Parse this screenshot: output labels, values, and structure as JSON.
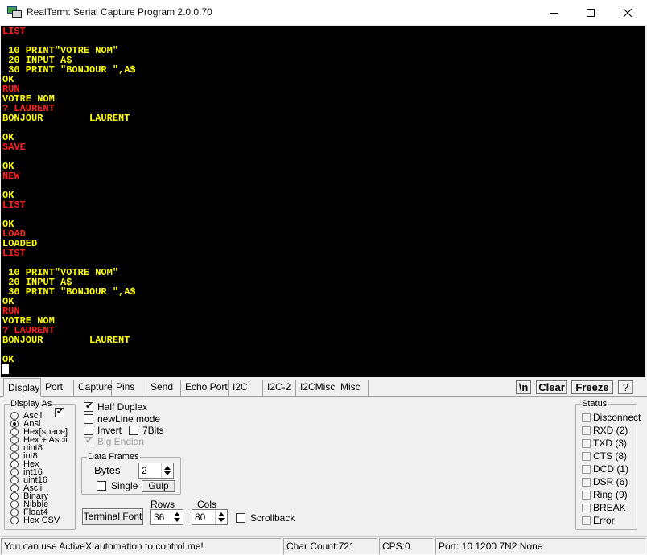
{
  "window": {
    "title": "RealTerm: Serial Capture Program 2.0.0.70"
  },
  "terminal": {
    "colors": {
      "background": "#000000",
      "echo": "#ff2020",
      "received": "#ffff00"
    },
    "lines": [
      {
        "text": "LIST",
        "color": "r"
      },
      {
        "text": "",
        "color": "y"
      },
      {
        "text": " 10 PRINT\"VOTRE NOM\"",
        "color": "y"
      },
      {
        "text": " 20 INPUT A$",
        "color": "y"
      },
      {
        "text": " 30 PRINT \"BONJOUR \",A$",
        "color": "y"
      },
      {
        "text": "OK",
        "color": "y"
      },
      {
        "text": "RUN",
        "color": "r"
      },
      {
        "text": "VOTRE NOM",
        "color": "y"
      },
      {
        "text": "? LAURENT",
        "color": "r"
      },
      {
        "text": "BONJOUR        LAURENT",
        "color": "y"
      },
      {
        "text": "",
        "color": "y"
      },
      {
        "text": "OK",
        "color": "y"
      },
      {
        "text": "SAVE",
        "color": "r"
      },
      {
        "text": "",
        "color": "y"
      },
      {
        "text": "OK",
        "color": "y"
      },
      {
        "text": "NEW",
        "color": "r"
      },
      {
        "text": "",
        "color": "y"
      },
      {
        "text": "OK",
        "color": "y"
      },
      {
        "text": "LIST",
        "color": "r"
      },
      {
        "text": "",
        "color": "y"
      },
      {
        "text": "OK",
        "color": "y"
      },
      {
        "text": "LOAD",
        "color": "r"
      },
      {
        "text": "LOADED",
        "color": "y"
      },
      {
        "text": "LIST",
        "color": "r"
      },
      {
        "text": "",
        "color": "y"
      },
      {
        "text": " 10 PRINT\"VOTRE NOM\"",
        "color": "y"
      },
      {
        "text": " 20 INPUT A$",
        "color": "y"
      },
      {
        "text": " 30 PRINT \"BONJOUR \",A$",
        "color": "y"
      },
      {
        "text": "OK",
        "color": "y"
      },
      {
        "text": "RUN",
        "color": "r"
      },
      {
        "text": "VOTRE NOM",
        "color": "y"
      },
      {
        "text": "? LAURENT",
        "color": "r"
      },
      {
        "text": "BONJOUR        LAURENT",
        "color": "y"
      },
      {
        "text": "",
        "color": "y"
      },
      {
        "text": "OK",
        "color": "y"
      }
    ]
  },
  "tabs": [
    {
      "label": "Display",
      "active": true
    },
    {
      "label": "Port"
    },
    {
      "label": "Capture"
    },
    {
      "label": "Pins"
    },
    {
      "label": "Send"
    },
    {
      "label": "Echo Port"
    },
    {
      "label": "I2C"
    },
    {
      "label": "I2C-2"
    },
    {
      "label": "I2CMisc"
    },
    {
      "label": "Misc"
    }
  ],
  "toolbar": {
    "newline_label": "\\n",
    "clear_label": "Clear",
    "freeze_label": "Freeze",
    "help_label": "?"
  },
  "display_as": {
    "legend": "Display As",
    "options": [
      {
        "label": "Ascii"
      },
      {
        "label": "Ansi",
        "selected": true
      },
      {
        "label": "Hex[space]"
      },
      {
        "label": "Hex + Ascii"
      },
      {
        "label": "uint8"
      },
      {
        "label": "int8"
      },
      {
        "label": "Hex"
      },
      {
        "label": "int16"
      },
      {
        "label": "uint16"
      },
      {
        "label": "Ascii"
      },
      {
        "label": "Binary"
      },
      {
        "label": "Nibble"
      },
      {
        "label": "Float4"
      },
      {
        "label": "Hex CSV"
      }
    ],
    "extra_checkbox_checked": true
  },
  "options": {
    "half_duplex": {
      "label": "Half Duplex",
      "checked": true
    },
    "newline_mode": {
      "label": "newLine mode",
      "checked": false
    },
    "invert": {
      "label": "Invert",
      "checked": false
    },
    "seven_bits": {
      "label": "7Bits",
      "checked": false
    },
    "big_endian": {
      "label": "Big Endian",
      "checked": true,
      "disabled": true
    }
  },
  "data_frames": {
    "legend": "Data Frames",
    "bytes_label": "Bytes",
    "bytes_value": "2",
    "single_label": "Single",
    "gulp_label": "Gulp"
  },
  "terminal_font_label": "Terminal Font",
  "rows": {
    "label": "Rows",
    "value": "36"
  },
  "cols": {
    "label": "Cols",
    "value": "80"
  },
  "scrollback_label": "Scrollback",
  "status": {
    "legend": "Status",
    "items": [
      "Disconnect",
      "RXD (2)",
      "TXD (3)",
      "CTS (8)",
      "DCD (1)",
      "DSR (6)",
      "Ring (9)",
      "BREAK",
      "Error"
    ]
  },
  "statusbar": {
    "message": "You can use ActiveX automation to control me!",
    "char_count": "Char Count:721",
    "cps": "CPS:0",
    "port": "Port: 10 1200 7N2 None"
  }
}
